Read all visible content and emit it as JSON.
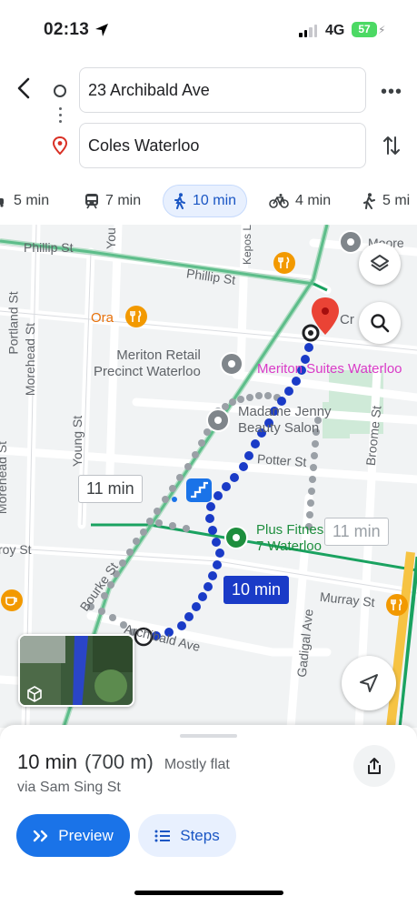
{
  "status_bar": {
    "time": "02:13",
    "network": "4G",
    "battery": "57"
  },
  "route": {
    "origin": "23 Archibald Ave",
    "destination": "Coles Waterloo"
  },
  "modes": [
    {
      "icon": "car-icon",
      "label": "5 min"
    },
    {
      "icon": "transit-icon",
      "label": "7 min"
    },
    {
      "icon": "walk-icon",
      "label": "10 min",
      "active": true
    },
    {
      "icon": "bike-icon",
      "label": "4 min"
    },
    {
      "icon": "rideshare-icon",
      "label": "5 mi"
    }
  ],
  "map": {
    "streets": [
      "Phillip St",
      "Phillip St",
      "Portland St",
      "Morehead St",
      "Morehead St",
      "Young St",
      "You",
      "Kepos L",
      "Potter St",
      "Bourke St",
      "Archibald Ave",
      "Murray St",
      "Gadigal Ave",
      "Broome St",
      "Moore",
      "Cr",
      "roy St"
    ],
    "pois": [
      "Ora",
      "Meriton Retail\nPrecinct Waterloo",
      "Meriton Suites Waterloo",
      "Madame Jenny\nBeauty Salon",
      "Plus Fitness 24\n7 Waterloo"
    ],
    "time_chips": [
      "11 min",
      "10 min",
      "11 min"
    ],
    "accent_route": "#1a3bc7",
    "poi_pink": "#d93ac7"
  },
  "sheet": {
    "duration": "10 min",
    "distance": "(700 m)",
    "terrain": "Mostly flat",
    "via": "via Sam Sing St",
    "preview_label": "Preview",
    "steps_label": "Steps"
  }
}
